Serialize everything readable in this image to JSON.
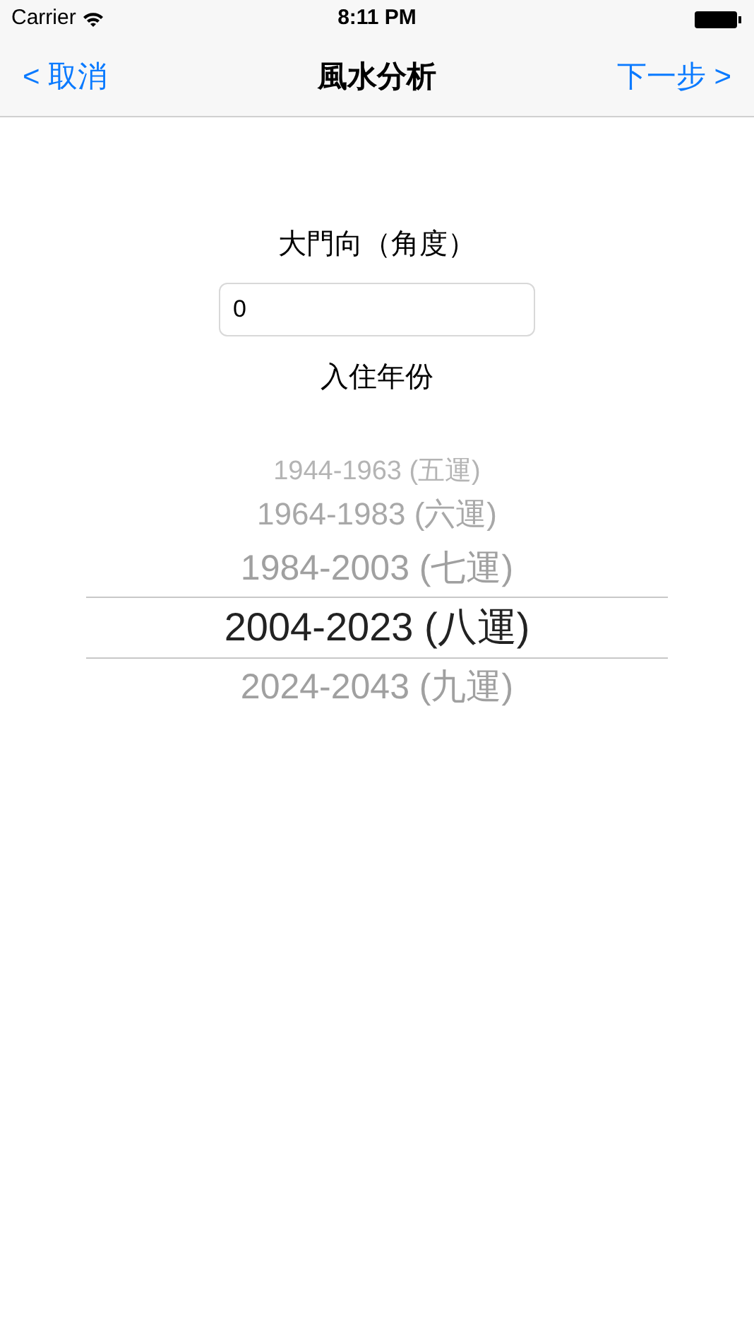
{
  "status_bar": {
    "carrier": "Carrier",
    "time": "8:11 PM"
  },
  "nav_bar": {
    "back": "< 取消",
    "title": "風水分析",
    "next": "下一步 >"
  },
  "door_field": {
    "label": "大門向（角度）",
    "value": "0"
  },
  "year_picker": {
    "label": "入住年份",
    "options": [
      {
        "text": "1944-1963 (五運)",
        "selected": false
      },
      {
        "text": "1964-1983 (六運)",
        "selected": false
      },
      {
        "text": "1984-2003 (七運)",
        "selected": false
      },
      {
        "text": "2004-2023 (八運)",
        "selected": true
      },
      {
        "text": "2024-2043 (九運)",
        "selected": false
      }
    ]
  }
}
